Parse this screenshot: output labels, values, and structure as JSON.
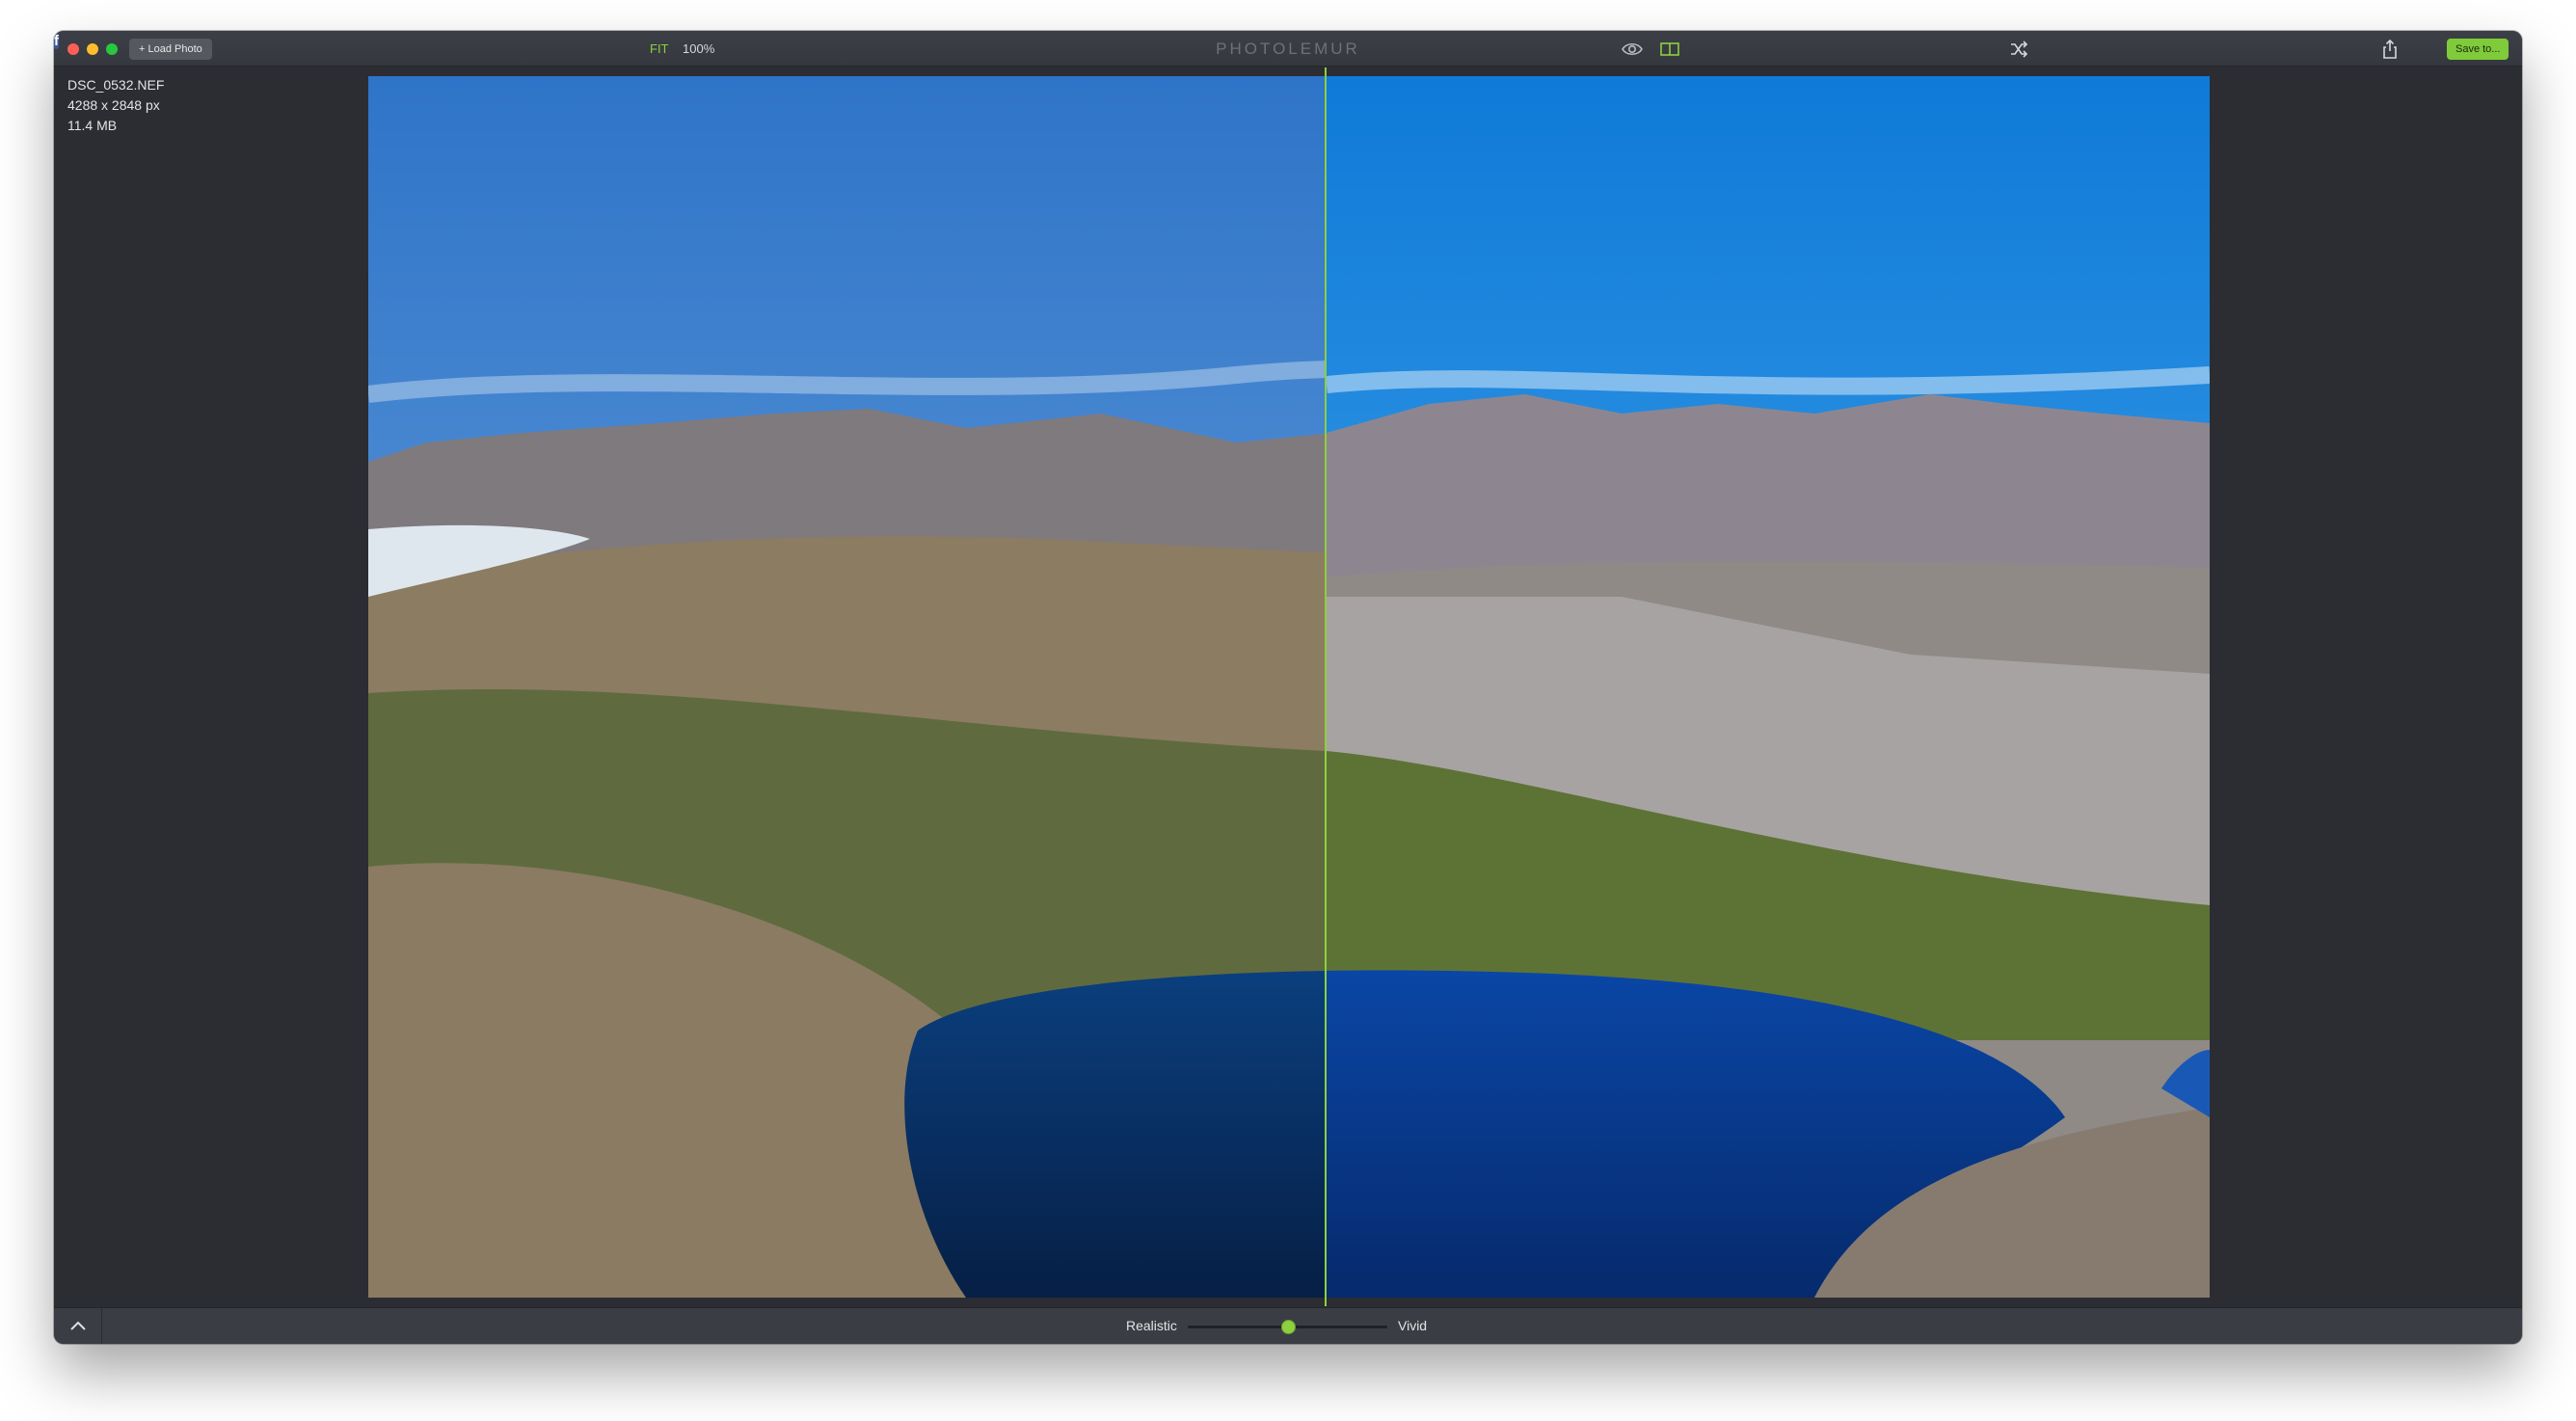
{
  "window": {
    "load_button": "+ Load Photo",
    "zoom_fit": "FIT",
    "zoom_100": "100%",
    "app_title": "PHOTOLEMUR",
    "save_button": "Save to...",
    "facebook_letter": "f"
  },
  "file_info": {
    "filename": "DSC_0532.NEF",
    "dimensions": "4288 x 2848  px",
    "size": "11.4 MB"
  },
  "icons": {
    "preview": "eye-icon",
    "compare": "split-compare-icon",
    "style": "shuffle-icon",
    "share": "share-icon",
    "facebook": "facebook-icon",
    "collapse": "chevron-up-icon"
  },
  "slider": {
    "left_label": "Realistic",
    "right_label": "Vivid",
    "value_fraction": 0.5
  },
  "colors": {
    "accent": "#8dcf3f",
    "window_bg": "#2b2d33"
  }
}
